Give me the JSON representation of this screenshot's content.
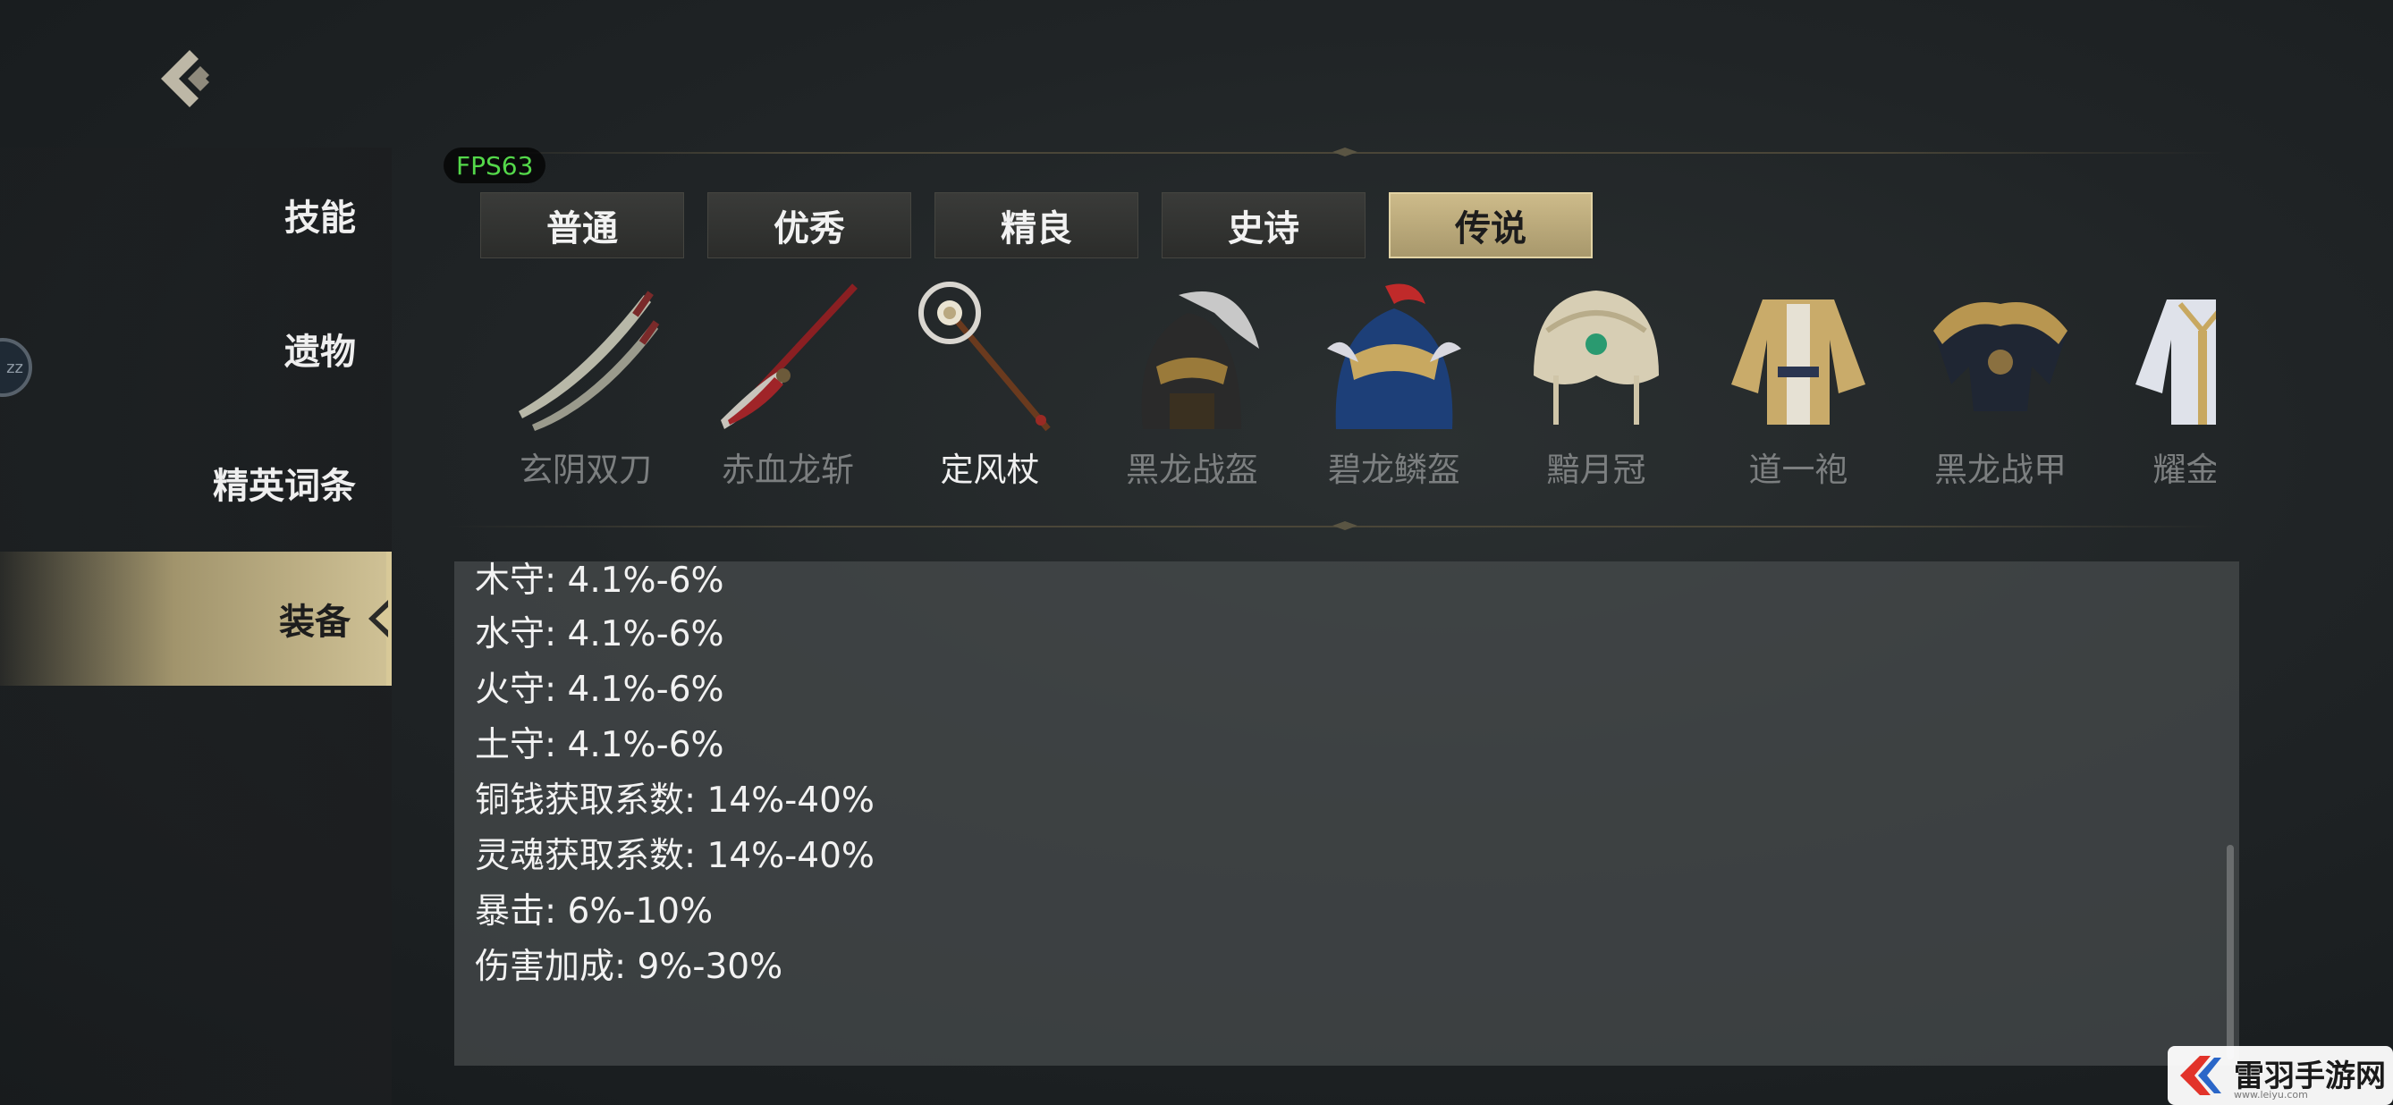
{
  "fps": "FPS63",
  "sidebar": {
    "items": [
      {
        "label": "技能"
      },
      {
        "label": "遗物"
      },
      {
        "label": "精英词条"
      },
      {
        "label": "装备"
      }
    ],
    "edge_badge": "zz"
  },
  "tabs": [
    {
      "label": "普通"
    },
    {
      "label": "优秀"
    },
    {
      "label": "精良"
    },
    {
      "label": "史诗"
    },
    {
      "label": "传说"
    }
  ],
  "active_tab": "传说",
  "items": [
    {
      "label": "玄阴双刀",
      "icon": "twin-blade-icon"
    },
    {
      "label": "赤血龙斩",
      "icon": "red-glaive-icon"
    },
    {
      "label": "定风杖",
      "icon": "staff-icon"
    },
    {
      "label": "黑龙战盔",
      "icon": "black-helmet-icon"
    },
    {
      "label": "碧龙鳞盔",
      "icon": "blue-helmet-icon"
    },
    {
      "label": "黯月冠",
      "icon": "crown-icon"
    },
    {
      "label": "道一袍",
      "icon": "robe-icon"
    },
    {
      "label": "黑龙战甲",
      "icon": "black-armor-icon"
    },
    {
      "label": "耀金羽",
      "icon": "gold-robe-icon"
    }
  ],
  "selected_item": "定风杖",
  "stats": [
    "木守: 4.1%-6%",
    "水守: 4.1%-6%",
    "火守: 4.1%-6%",
    "土守: 4.1%-6%",
    "铜钱获取系数: 14%-40%",
    "灵魂获取系数: 14%-40%",
    "暴击: 6%-10%",
    "伤害加成: 9%-30%"
  ],
  "watermark": {
    "title": "雷羽手游网",
    "url": "www.leiyu.com"
  },
  "colors": {
    "accent_gold": "#cdbb8a",
    "fps_green": "#54d84a"
  }
}
